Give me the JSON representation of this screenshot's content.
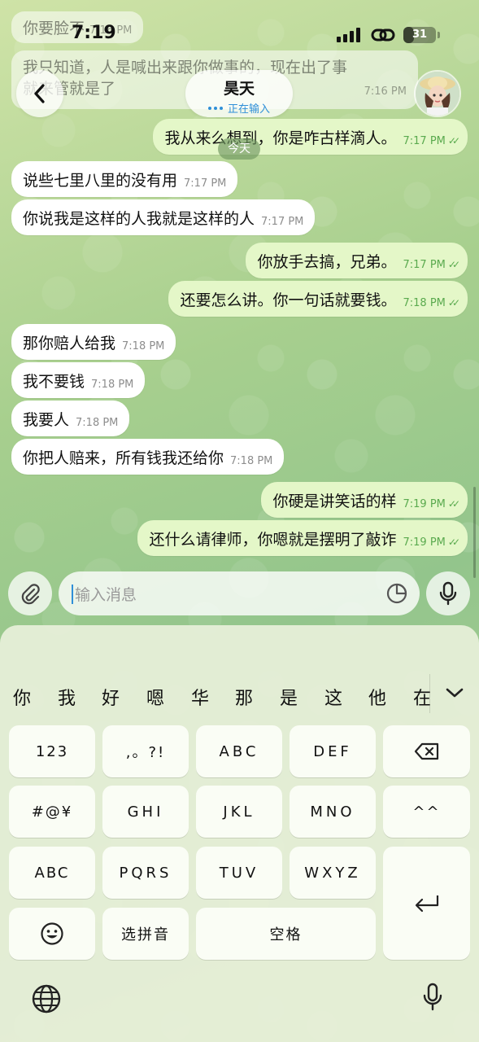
{
  "status_bar": {
    "time": "7:19",
    "battery": "31"
  },
  "ghost_messages": [
    {
      "text": "你要脸不",
      "time": "7:16 PM"
    },
    {
      "line1": "我只知道，人是喊出来跟你做事的，现在出了事",
      "line2": "就来管就是了",
      "time": "7:16 PM"
    }
  ],
  "header": {
    "contact_name": "昊天",
    "status": "正在输入"
  },
  "date_chip": "今天",
  "messages": [
    {
      "text": "我从来么想到，你是咋古样滴人。",
      "time": "7:17 PM"
    },
    {
      "text": "说些七里八里的没有用",
      "time": "7:17 PM"
    },
    {
      "text": "你说我是这样的人我就是这样的人",
      "time": "7:17 PM"
    },
    {
      "text": "你放手去搞，兄弟。",
      "time": "7:17 PM"
    },
    {
      "text": "还要怎么讲。你一句话就要钱。",
      "time": "7:18 PM"
    },
    {
      "text": "那你赔人给我",
      "time": "7:18 PM"
    },
    {
      "text": "我不要钱",
      "time": "7:18 PM"
    },
    {
      "text": "我要人",
      "time": "7:18 PM"
    },
    {
      "text": "你把人赔来，所有钱我还给你",
      "time": "7:18 PM"
    },
    {
      "text": "你硬是讲笑话的样",
      "time": "7:19 PM"
    },
    {
      "text": "还什么请律师，你嗯就是摆明了敲诈",
      "time": "7:19 PM"
    }
  ],
  "input": {
    "placeholder": "输入消息"
  },
  "keyboard": {
    "candidates": [
      "你",
      "我",
      "好",
      "嗯",
      "华",
      "那",
      "是",
      "这",
      "他",
      "在"
    ],
    "keys": {
      "num": "123",
      "punct": ",。?!",
      "abc": "ABC",
      "def": "DEF",
      "symbols": "#@¥",
      "ghi": "GHI",
      "jkl": "JKL",
      "mno": "MNO",
      "emoticon": "^^",
      "abc_mode": "ABC",
      "pqrs": "PQRS",
      "tuv": "TUV",
      "wxyz": "WXYZ",
      "pinyin": "选拼音",
      "space": "空格"
    }
  },
  "colors": {
    "outgoing_bubble": "#e4f7c8",
    "incoming_bubble": "#ffffff",
    "accent": "#2f8fd8",
    "read_ticks": "#5aaa4e"
  }
}
